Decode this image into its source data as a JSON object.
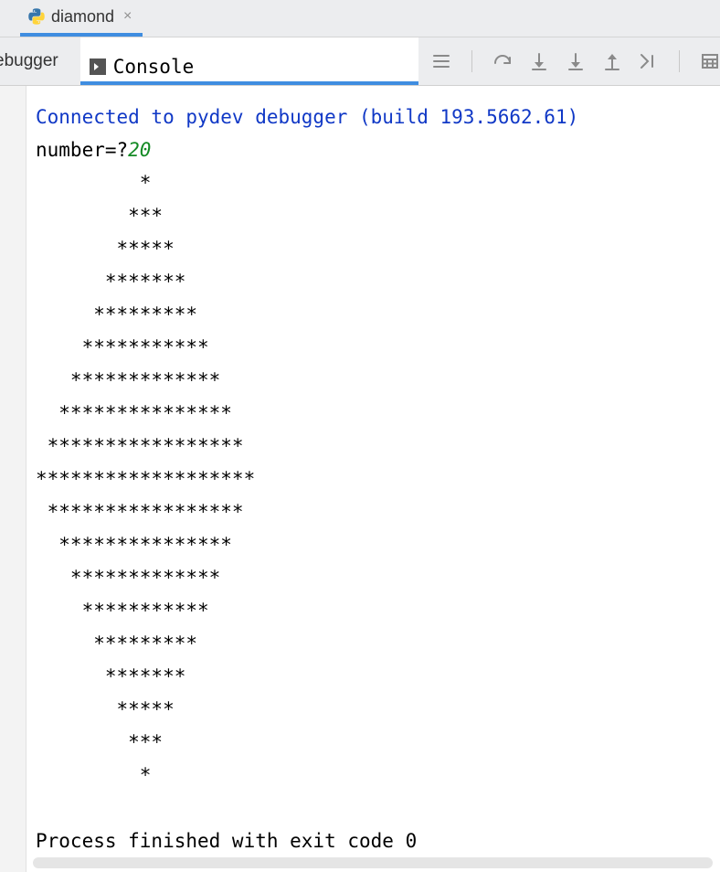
{
  "file_tab": {
    "name": "diamond",
    "icon": "python-file-icon",
    "close_icon": "close-icon"
  },
  "view_tabs": {
    "debugger": "ebugger",
    "console": "Console"
  },
  "toolbar_icons": [
    "soft-wrap-icon",
    "step-over-icon",
    "step-into-icon",
    "step-into-my-code-icon",
    "step-out-icon",
    "run-to-cursor-icon",
    "evaluate-expression-icon"
  ],
  "console_output": {
    "connect_line": "Connected to pydev debugger (build 193.5662.61)",
    "prompt_prefix": "number=?",
    "prompt_value": "20",
    "diamond_lines": [
      "         *",
      "        ***",
      "       *****",
      "      *******",
      "     *********",
      "    ***********",
      "   *************",
      "  ***************",
      " *****************",
      "*******************",
      " *****************",
      "  ***************",
      "   *************",
      "    ***********",
      "     *********",
      "      *******",
      "       *****",
      "        ***",
      "         *"
    ],
    "blank_after": "",
    "exit_line": "Process finished with exit code 0"
  }
}
